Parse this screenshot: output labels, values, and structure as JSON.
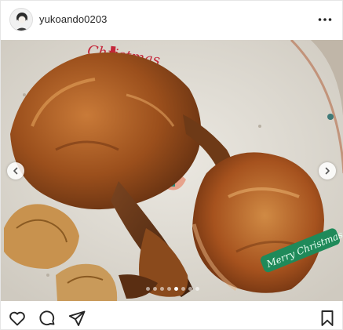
{
  "post": {
    "username": "yukoando0203",
    "plate_text_top": "Christmas",
    "plate_text_bottom": "Merry Christmas"
  },
  "carousel": {
    "slide_count": 8,
    "active_index": 4
  },
  "icons": {
    "more": "more-options-icon",
    "prev": "chevron-left-icon",
    "next": "chevron-right-icon",
    "like": "heart-icon",
    "comment": "comment-icon",
    "share": "paper-plane-icon",
    "save": "bookmark-icon"
  },
  "colors": {
    "plate": "#e4e2dc",
    "chicken": "#a0521e",
    "red_text": "#c4263a",
    "green_text": "#1f8a5a"
  }
}
